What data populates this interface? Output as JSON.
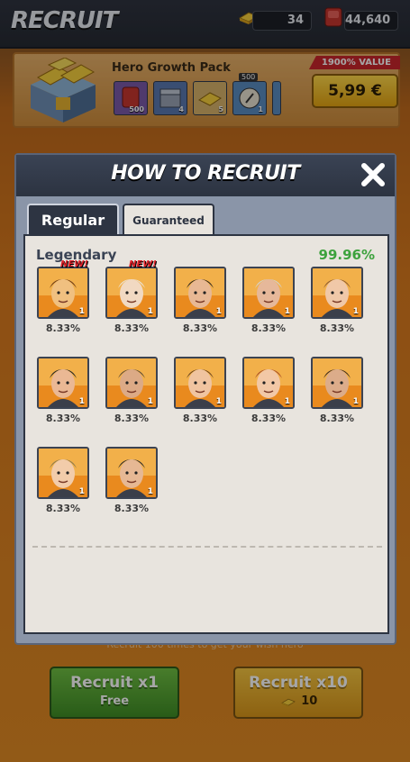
{
  "header": {
    "title": "RECRUIT",
    "gold": "34",
    "rubies": "44,640"
  },
  "offer": {
    "title": "Hero Growth Pack",
    "tag": "1900% VALUE",
    "price": "5,99 €",
    "items": [
      {
        "name": "ruby",
        "qty": "500"
      },
      {
        "name": "chest",
        "qty": "4"
      },
      {
        "name": "gold",
        "qty": "5"
      },
      {
        "name": "scroll",
        "qty": "1",
        "top": "500"
      }
    ]
  },
  "modal": {
    "title": "HOW TO RECRUIT",
    "tabs": [
      "Regular",
      "Guaranteed"
    ],
    "active_tab": "Guaranteed",
    "section": {
      "title": "Legendary",
      "rate": "99.96%"
    },
    "heroes": [
      {
        "pct": "8.33%",
        "level": "1",
        "new": "NEW!"
      },
      {
        "pct": "8.33%",
        "level": "1",
        "new": "NEW!"
      },
      {
        "pct": "8.33%",
        "level": "1",
        "new": ""
      },
      {
        "pct": "8.33%",
        "level": "1",
        "new": ""
      },
      {
        "pct": "8.33%",
        "level": "1",
        "new": ""
      },
      {
        "pct": "8.33%",
        "level": "1",
        "new": ""
      },
      {
        "pct": "8.33%",
        "level": "1",
        "new": ""
      },
      {
        "pct": "8.33%",
        "level": "1",
        "new": ""
      },
      {
        "pct": "8.33%",
        "level": "1",
        "new": ""
      },
      {
        "pct": "8.33%",
        "level": "1",
        "new": ""
      },
      {
        "pct": "8.33%",
        "level": "1",
        "new": ""
      },
      {
        "pct": "8.33%",
        "level": "1",
        "new": ""
      }
    ]
  },
  "footer": {
    "hint": "Recruit 100 times to get your wish hero",
    "recruit_x1": {
      "label": "Recruit x1",
      "sub": "Free"
    },
    "recruit_x10": {
      "label": "Recruit x10",
      "cost": "10"
    }
  },
  "colors": {
    "accent_green": "#3da23d",
    "price_yellow": "#ffd84a",
    "tag_red": "#c9262c",
    "new_red": "#e0232a"
  }
}
